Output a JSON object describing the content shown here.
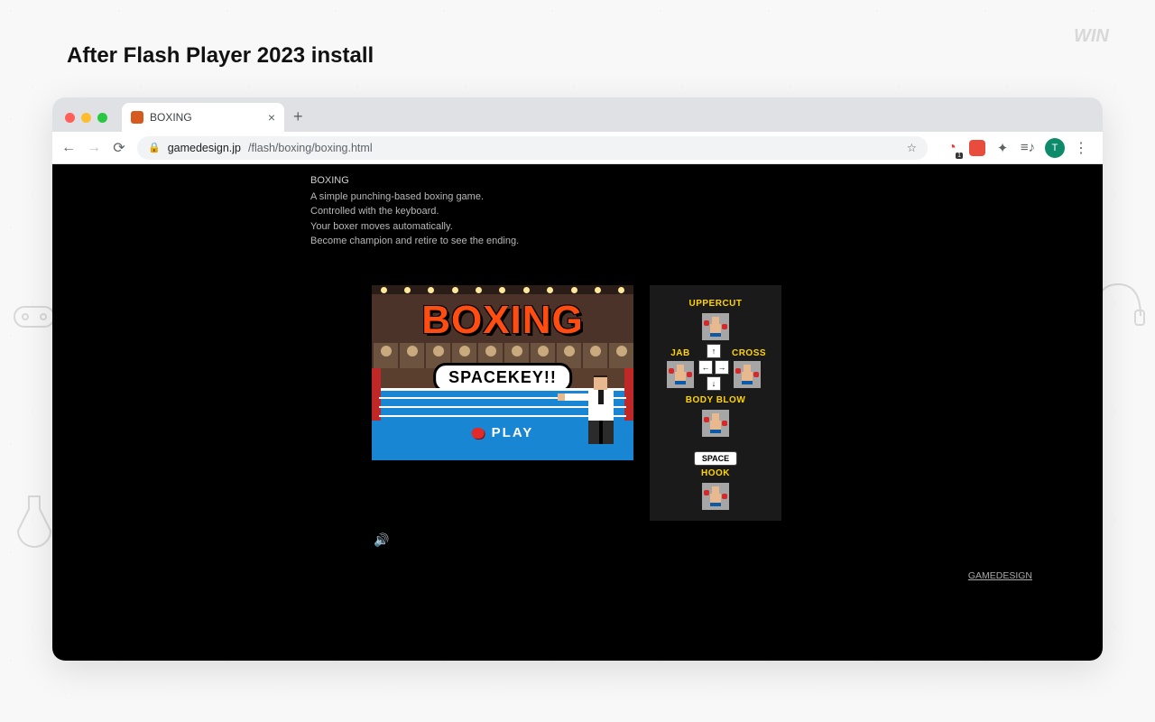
{
  "page": {
    "heading": "After Flash Player 2023 install"
  },
  "browser": {
    "tab": {
      "title": "BOXING"
    },
    "url": {
      "host": "gamedesign.jp",
      "path": "/flash/boxing/boxing.html"
    },
    "avatar_initial": "T"
  },
  "content": {
    "title": "BOXING",
    "lines": [
      "A simple punching-based boxing game.",
      "Controlled with the keyboard.",
      "Your boxer moves automatically.",
      "Become champion and retire to see the ending."
    ],
    "game": {
      "logo": "BOXING",
      "banner": "SPACEKEY!!",
      "play": "PLAY"
    },
    "controls": {
      "uppercut": "UPPERCUT",
      "jab": "JAB",
      "cross": "CROSS",
      "bodyblow": "BODY BLOW",
      "space": "SPACE",
      "hook": "HOOK",
      "arrows": {
        "up": "↑",
        "down": "↓",
        "left": "←",
        "right": "→"
      }
    },
    "footer_link": "GAMEDESIGN"
  }
}
